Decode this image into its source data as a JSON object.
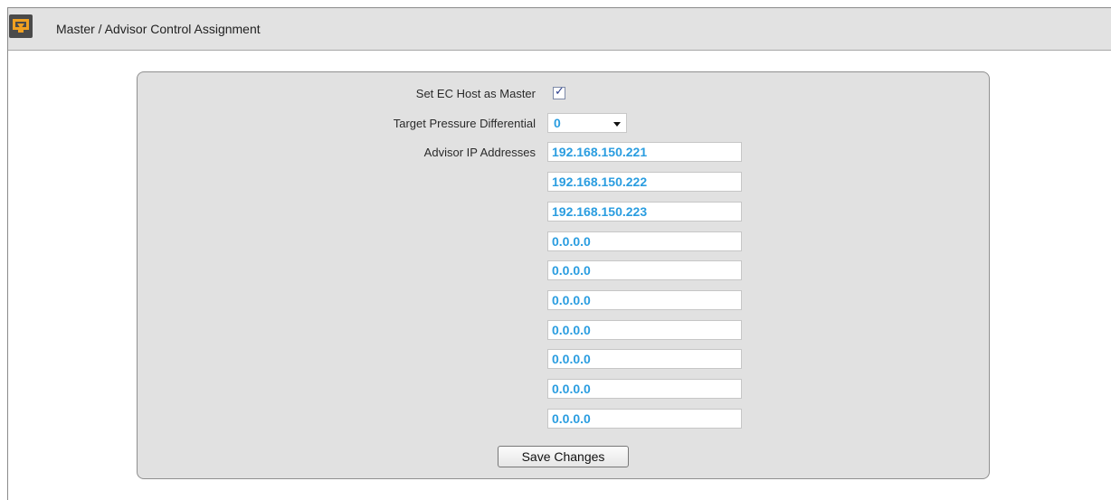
{
  "header": {
    "title": "Master / Advisor Control Assignment",
    "icon": "monitor-download-icon"
  },
  "form": {
    "master_label": "Set EC Host as Master",
    "master_checked": true,
    "pressure_label": "Target Pressure Differential",
    "pressure_value": "0",
    "advisor_label": "Advisor IP Addresses",
    "advisor_ips": [
      "192.168.150.221",
      "192.168.150.222",
      "192.168.150.223",
      "0.0.0.0",
      "0.0.0.0",
      "0.0.0.0",
      "0.0.0.0",
      "0.0.0.0",
      "0.0.0.0",
      "0.0.0.0"
    ],
    "save_label": "Save Changes"
  },
  "colors": {
    "value_text": "#2a9de0",
    "panel_bg": "#e1e1e1",
    "titlebar_bg": "#e2e2e2",
    "icon_accent": "#f0a020"
  }
}
